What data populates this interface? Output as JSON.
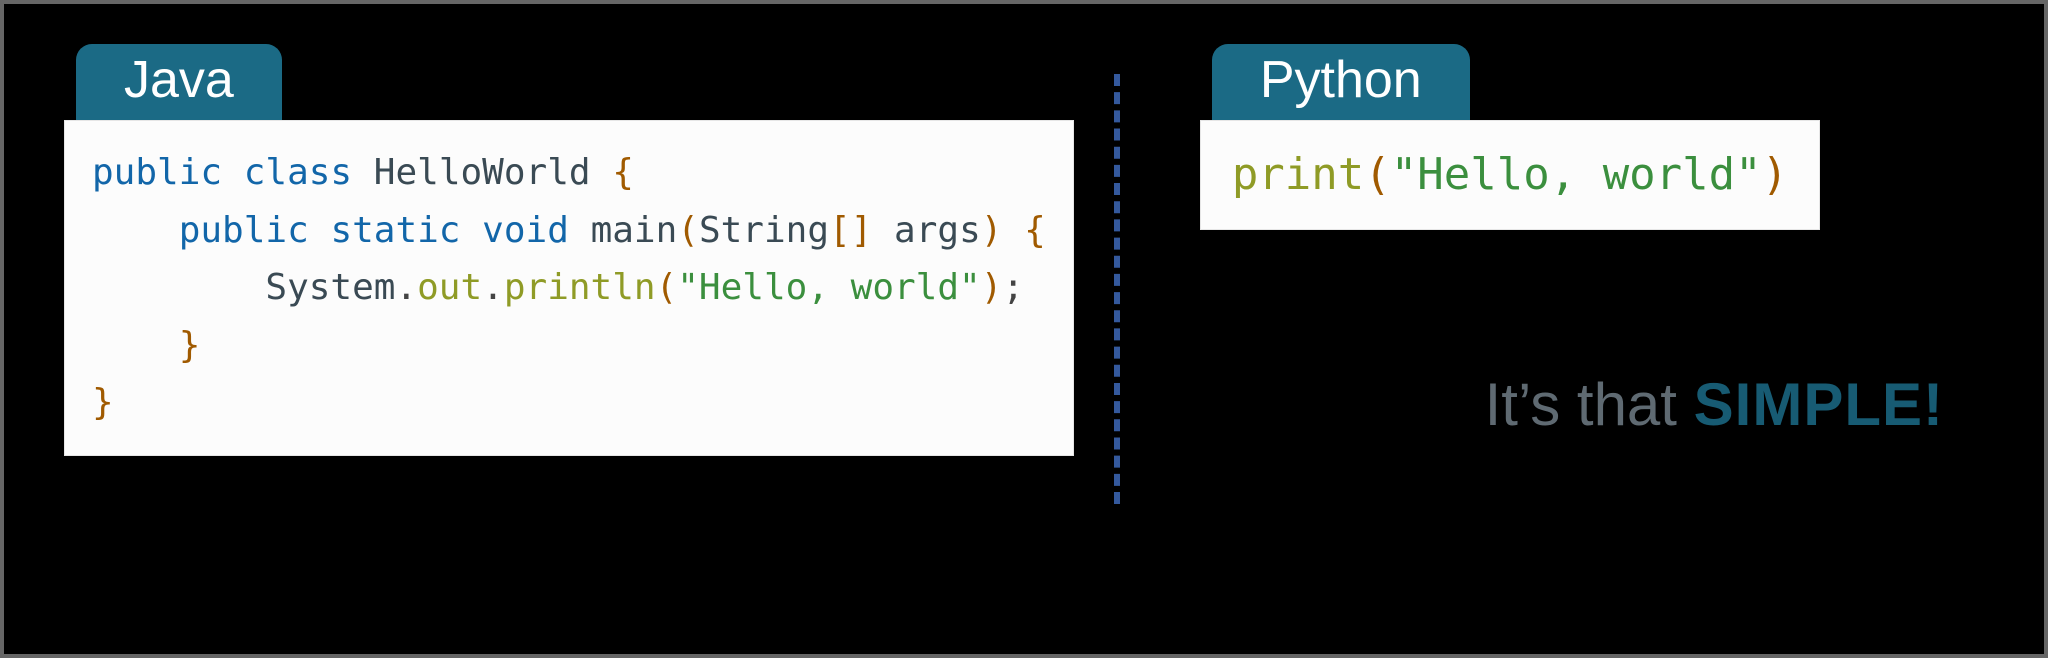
{
  "left": {
    "badge": "Java",
    "code": {
      "l1": {
        "kw1": "public",
        "kw2": "class",
        "name": "HelloWorld",
        "ob": "{"
      },
      "l2": {
        "kw1": "public",
        "kw2": "static",
        "kw3": "void",
        "fn": "main",
        "op": "(",
        "argtype": "String",
        "br": "[]",
        "argname": "args",
        "cp": ")",
        "ob": "{"
      },
      "l3": {
        "cls": "System",
        "dot1": ".",
        "m1": "out",
        "dot2": ".",
        "m2": "println",
        "op": "(",
        "str": "\"Hello, world\"",
        "cp": ")",
        "semi": ";"
      },
      "l4": {
        "cb": "}"
      },
      "l5": {
        "cb": "}"
      }
    }
  },
  "right": {
    "badge": "Python",
    "code": {
      "fn": "print",
      "op": "(",
      "str": "\"Hello, world\"",
      "cp": ")"
    }
  },
  "tagline": {
    "prefix": "It’s that ",
    "emph": "SIMPLE",
    "suffix": "!"
  }
}
